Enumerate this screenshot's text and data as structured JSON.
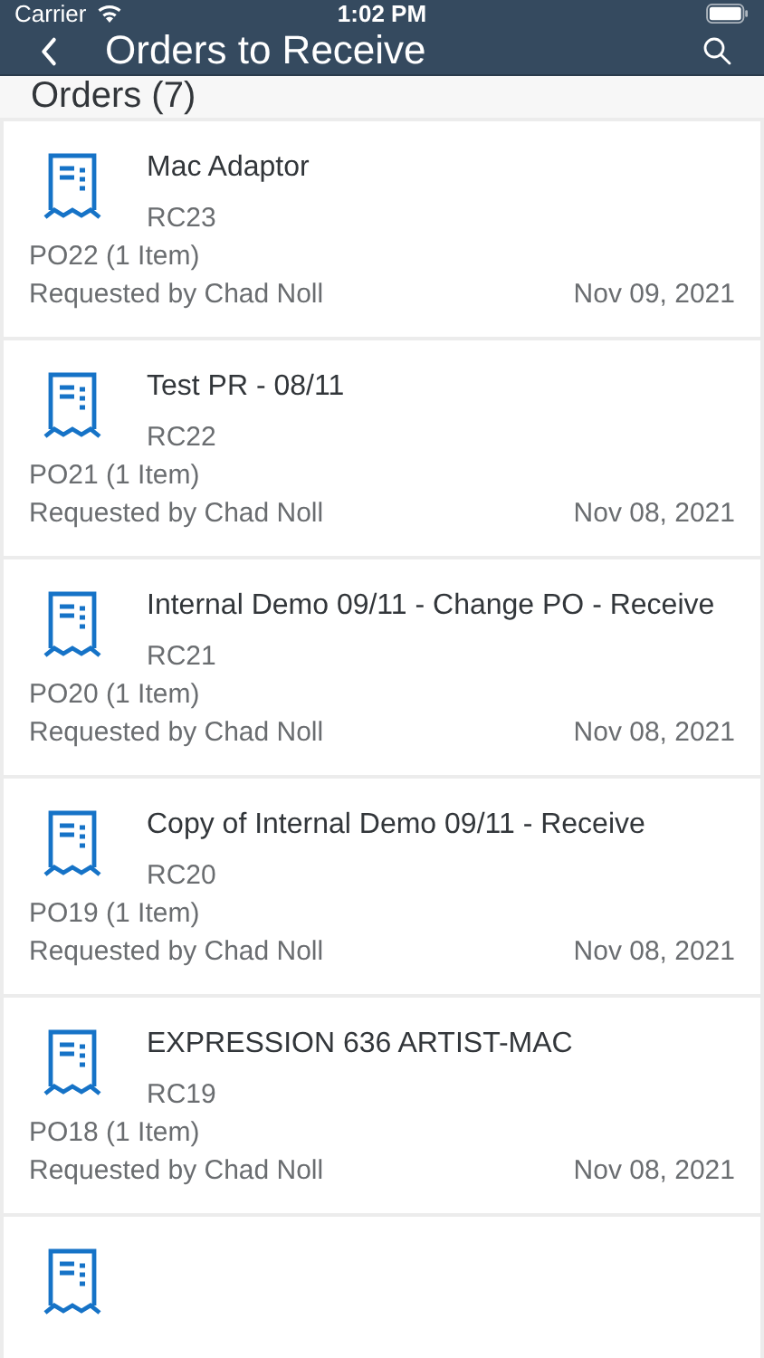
{
  "status_bar": {
    "carrier": "Carrier",
    "time": "1:02 PM"
  },
  "nav_bar": {
    "title": "Orders to Receive"
  },
  "section": {
    "title": "Orders (7)"
  },
  "orders": [
    {
      "title": "Mac Adaptor",
      "code": "RC23",
      "po": "PO22 (1 Item)",
      "requester": "Requested by Chad Noll",
      "date": "Nov 09, 2021"
    },
    {
      "title": "Test PR - 08/11",
      "code": "RC22",
      "po": "PO21 (1 Item)",
      "requester": "Requested by Chad Noll",
      "date": "Nov 08, 2021"
    },
    {
      "title": "Internal Demo 09/11 - Change PO - Receive",
      "code": "RC21",
      "po": "PO20 (1 Item)",
      "requester": "Requested by Chad Noll",
      "date": "Nov 08, 2021"
    },
    {
      "title": "Copy of Internal Demo 09/11 - Receive",
      "code": "RC20",
      "po": "PO19 (1 Item)",
      "requester": "Requested by Chad Noll",
      "date": "Nov 08, 2021"
    },
    {
      "title": "EXPRESSION 636 ARTIST-MAC",
      "code": "RC19",
      "po": "PO18 (1 Item)",
      "requester": "Requested by Chad Noll",
      "date": "Nov 08, 2021"
    }
  ]
}
